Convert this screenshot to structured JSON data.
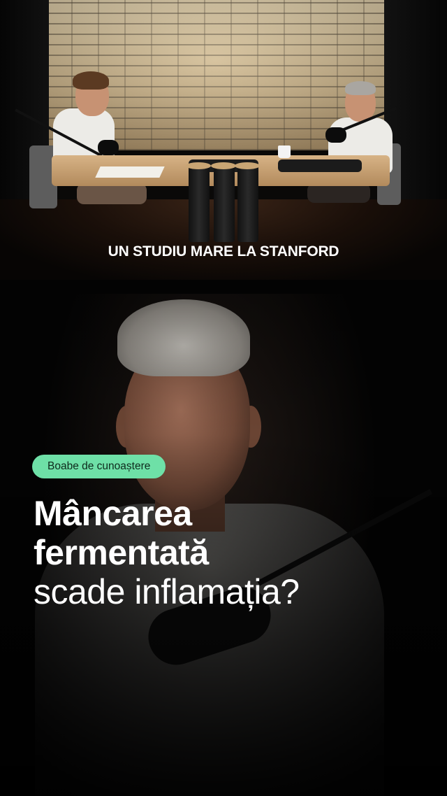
{
  "top_scene": {
    "caption": "UN STUDIU MARE LA STANFORD"
  },
  "overlay": {
    "badge": "Boabe de cunoaștere",
    "headline_line1": "Mâncarea",
    "headline_line2": "fermentată",
    "headline_line3": "scade inflamația?"
  },
  "colors": {
    "badge_bg": "#6ee0a7",
    "text": "#ffffff",
    "background": "#000000"
  }
}
